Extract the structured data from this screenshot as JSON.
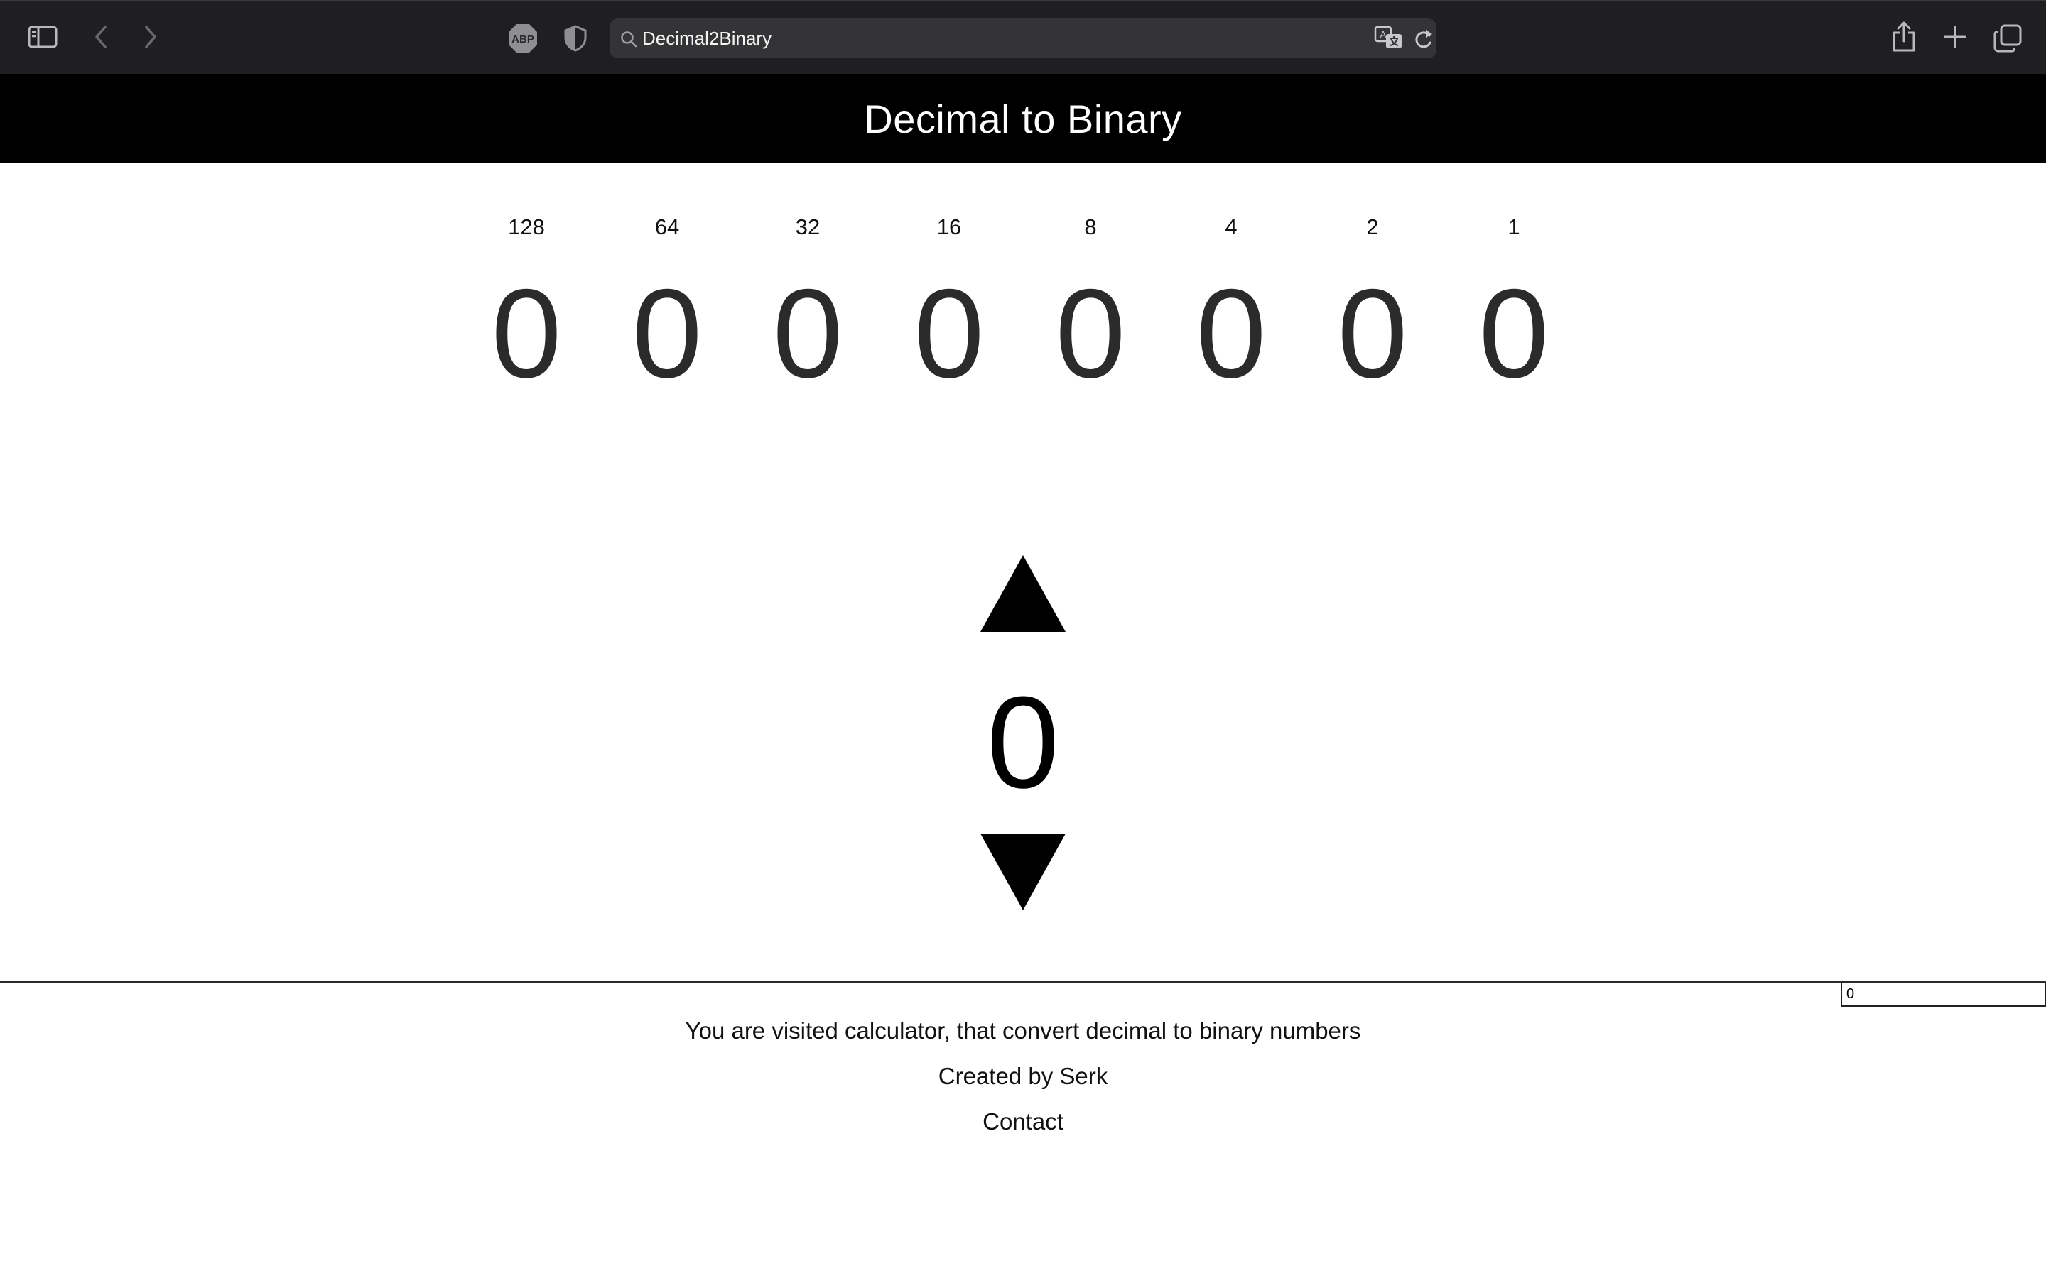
{
  "browser": {
    "address_text": "Decimal2Binary",
    "icons": [
      "sidebar-icon",
      "back-icon",
      "forward-icon",
      "adblock-icon",
      "shield-icon",
      "search-icon",
      "translate-icon",
      "reload-icon",
      "share-icon",
      "plus-icon",
      "tabs-overview-icon"
    ],
    "adblock_label": "ABP"
  },
  "page": {
    "title": "Decimal to Binary"
  },
  "bits": [
    {
      "weight": "128",
      "value": "0"
    },
    {
      "weight": "64",
      "value": "0"
    },
    {
      "weight": "32",
      "value": "0"
    },
    {
      "weight": "16",
      "value": "0"
    },
    {
      "weight": "8",
      "value": "0"
    },
    {
      "weight": "4",
      "value": "0"
    },
    {
      "weight": "2",
      "value": "0"
    },
    {
      "weight": "1",
      "value": "0"
    }
  ],
  "stepper": {
    "decimal_value": "0"
  },
  "input": {
    "value": "0"
  },
  "footer": {
    "line1": "You are visited calculator, that convert decimal to binary numbers",
    "line2": "Created by Serk",
    "contact": "Contact"
  },
  "colors": {
    "toolbar_bg": "#1f1f21",
    "address_bg": "#343437",
    "header_bg": "#000000",
    "page_bg": "#ffffff"
  }
}
